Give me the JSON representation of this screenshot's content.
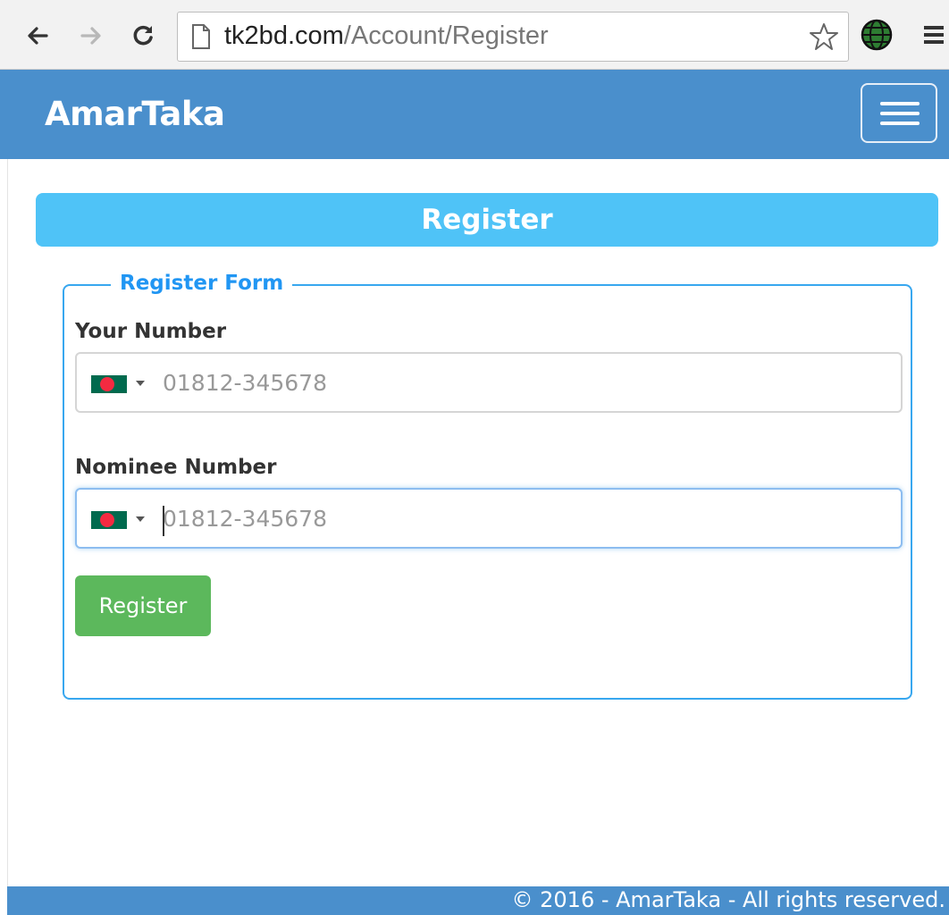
{
  "browser": {
    "url_host": "tk2bd.com",
    "url_path": "/Account/Register"
  },
  "navbar": {
    "brand": "AmarTaka"
  },
  "page": {
    "title": "Register"
  },
  "form": {
    "legend": "Register Form",
    "your_number": {
      "label": "Your Number",
      "placeholder": "01812-345678",
      "value": ""
    },
    "nominee_number": {
      "label": "Nominee Number",
      "placeholder": "01812-345678",
      "value": ""
    },
    "submit_label": "Register"
  },
  "footer": {
    "text": "© 2016 - AmarTaka - All rights reserved."
  },
  "colors": {
    "navbar": "#4a8fcc",
    "title_bar": "#4fc3f7",
    "fieldset_border": "#38a7ef",
    "legend_text": "#2196f3",
    "button": "#5cb85c",
    "flag_green": "#006a4e",
    "flag_red": "#f42a41"
  },
  "icons": {
    "back": "arrow-left-icon",
    "forward": "arrow-right-icon",
    "reload": "reload-icon",
    "page": "page-icon",
    "bookmark": "star-icon",
    "extension": "globe-icon",
    "menu": "hamburger-icon",
    "flag": "bangladesh-flag-icon"
  }
}
